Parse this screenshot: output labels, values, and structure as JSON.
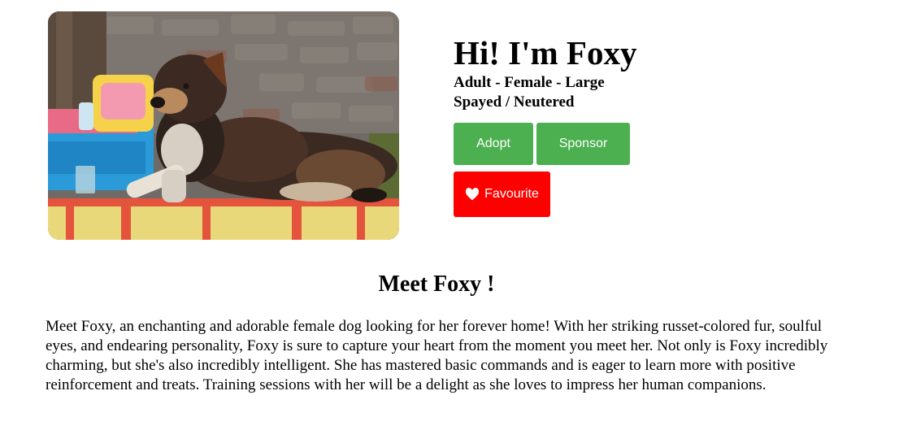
{
  "pet": {
    "greeting": "Hi! I'm Foxy",
    "attributes": "Adult - Female - Large",
    "status": "Spayed / Neutered",
    "photo_icon": "dog-photo"
  },
  "actions": {
    "adopt_label": "Adopt",
    "sponsor_label": "Sponsor",
    "favourite_label": "Favourite",
    "favourite_icon": "heart-icon"
  },
  "colors": {
    "primary_button": "#4caf50",
    "favourite_button": "#ff0000"
  },
  "about": {
    "title": "Meet Foxy !",
    "text": "Meet Foxy, an enchanting and adorable female dog looking for her forever home! With her striking russet-colored fur, soulful eyes, and endearing personality, Foxy is sure to capture your heart from the moment you meet her. Not only is Foxy incredibly charming, but she's also incredibly intelligent. She has mastered basic commands and is eager to learn more with positive reinforcement and treats. Training sessions with her will be a delight as she loves to impress her human companions."
  }
}
